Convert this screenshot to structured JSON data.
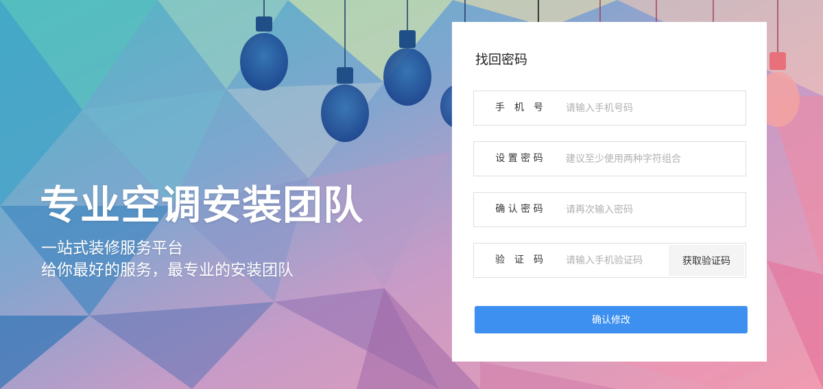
{
  "hero": {
    "title": "专业空调安装团队",
    "subtitle_line1": "一站式装修服务平台",
    "subtitle_line2": "给你最好的服务，最专业的安装团队"
  },
  "form": {
    "title": "找回密码",
    "phone": {
      "label": "手　机　号",
      "placeholder": "请输入手机号码"
    },
    "password": {
      "label": "设 置 密 码",
      "placeholder": "建议至少使用两种字符组合"
    },
    "confirm_password": {
      "label": "确 认 密 码",
      "placeholder": "请再次输入密码"
    },
    "code": {
      "label": "验　证　码",
      "placeholder": "请输入手机验证码",
      "button_label": "获取验证码"
    },
    "submit_label": "确认修改"
  },
  "colors": {
    "primary": "#3d8ff0",
    "panel_bg": "#ffffff",
    "input_border": "#dedede",
    "code_button_bg": "#f4f4f4"
  },
  "icons": [
    "light-bulb-icon"
  ]
}
